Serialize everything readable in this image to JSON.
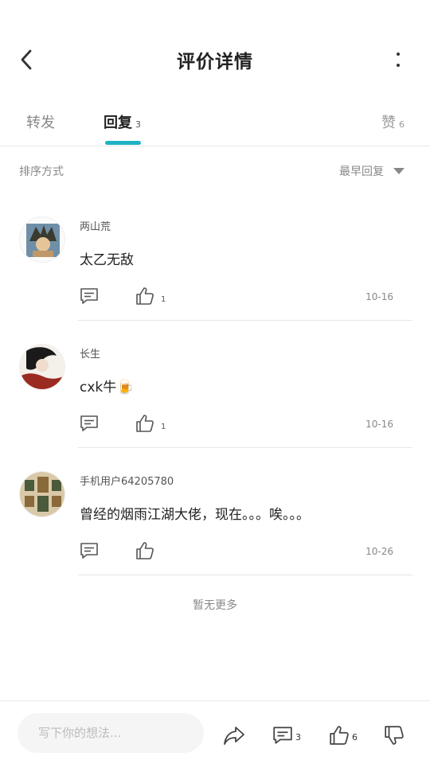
{
  "header": {
    "title": "评价详情"
  },
  "tabs": {
    "forward": {
      "label": "转发"
    },
    "reply": {
      "label": "回复",
      "count": "3"
    },
    "like": {
      "label": "赞",
      "count": "6"
    }
  },
  "sort": {
    "label": "排序方式",
    "selected": "最早回复"
  },
  "comments": [
    {
      "user": "两山荒",
      "text": "太乙无敌",
      "likes": "1",
      "date": "10-16",
      "avatar_colors": [
        "#6f8fa8",
        "#c09868",
        "#3a3a2e"
      ]
    },
    {
      "user": "长生",
      "text": "cxk牛",
      "emoji": "🍺",
      "likes": "1",
      "date": "10-16",
      "avatar_colors": [
        "#f4f0ea",
        "#9b2a22",
        "#1a1a1a"
      ]
    },
    {
      "user": "手机用户64205780",
      "text": "曾经的烟雨江湖大佬，现在。。。唉。。。",
      "likes": "",
      "date": "10-26",
      "avatar_colors": [
        "#d9c9a8",
        "#8a6a3a",
        "#4a5a3a"
      ]
    }
  ],
  "footer": {
    "no_more": "暂无更多"
  },
  "bottombar": {
    "input_placeholder": "写下你的想法...",
    "comment_count": "3",
    "like_count": "6"
  },
  "icons": {
    "back": "chevron-left-icon",
    "more": "more-vertical-icon",
    "reply": "comment-bubble-icon",
    "like": "thumbs-up-icon",
    "share": "share-arrow-icon",
    "dislike": "thumbs-down-icon"
  },
  "colors": {
    "accent": "#1fb2c4"
  }
}
